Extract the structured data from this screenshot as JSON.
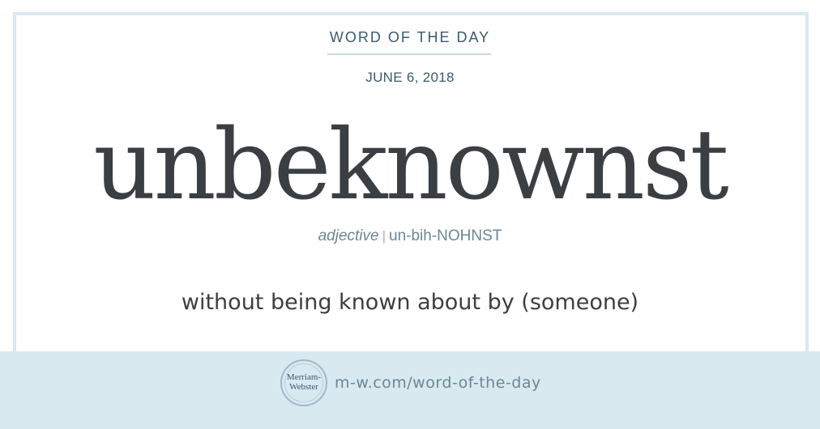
{
  "header": {
    "title": "WORD OF THE DAY",
    "date": "JUNE 6, 2018"
  },
  "entry": {
    "word": "unbeknownst",
    "part_of_speech": "adjective",
    "separator": "|",
    "pronunciation": "un-bih-NOHNST",
    "definition": "without being known about by (someone)"
  },
  "footer": {
    "logo_text": "Merriam-Webster",
    "url": "m-w.com/word-of-the-day"
  },
  "colors": {
    "frame": "#d9e9f0",
    "heading": "#3a5a6e",
    "word": "#3b3f44",
    "pronunciation": "#6b8796"
  }
}
